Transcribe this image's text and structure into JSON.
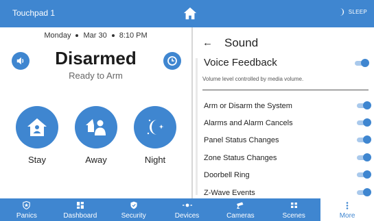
{
  "topbar": {
    "device_name": "Touchpad 1",
    "home_icon": "home-icon",
    "sleep_label": "SLEEP",
    "sleep_icon": "moon-icon"
  },
  "status_panel": {
    "day": "Monday",
    "date": "Mar 30",
    "time": "8:10 PM",
    "status": "Disarmed",
    "substatus": "Ready to Arm",
    "sound_icon": "speaker-icon",
    "clock_icon": "clock-icon",
    "arm_modes": [
      {
        "label": "Stay",
        "icon": "home-person-icon"
      },
      {
        "label": "Away",
        "icon": "people-home-icon"
      },
      {
        "label": "Night",
        "icon": "moon-stars-icon"
      }
    ]
  },
  "sound": {
    "back_icon": "back-arrow-icon",
    "title": "Sound",
    "voice_feedback_label": "Voice Feedback",
    "voice_feedback_on": true,
    "voice_feedback_note": "Volume level controlled by media volume.",
    "items": [
      {
        "label": "Arm or Disarm the System",
        "on": true
      },
      {
        "label": "Alarms and Alarm Cancels",
        "on": true
      },
      {
        "label": "Panel Status Changes",
        "on": true
      },
      {
        "label": "Zone Status Changes",
        "on": true
      },
      {
        "label": "Doorbell Ring",
        "on": true
      },
      {
        "label": "Z-Wave Events",
        "on": true
      }
    ]
  },
  "nav": [
    {
      "label": "Panics",
      "icon": "shield-star-icon"
    },
    {
      "label": "Dashboard",
      "icon": "grid-icon"
    },
    {
      "label": "Security",
      "icon": "shield-check-icon"
    },
    {
      "label": "Devices",
      "icon": "devices-icon"
    },
    {
      "label": "Cameras",
      "icon": "camera-icon"
    },
    {
      "label": "Scenes",
      "icon": "scenes-icon"
    },
    {
      "label": "More",
      "icon": "more-vertical-icon",
      "active": true
    }
  ],
  "colors": {
    "accent": "#3f86d0",
    "toggle_track": "#a9c9ec",
    "active_nav_bg": "#ffffff"
  }
}
